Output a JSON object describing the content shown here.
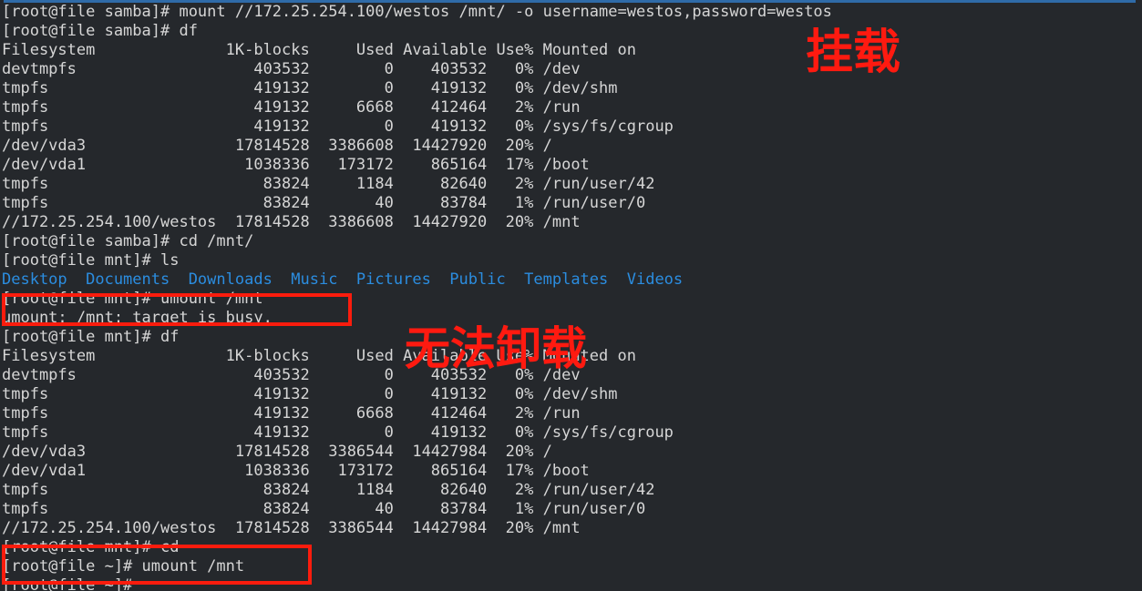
{
  "terminal": {
    "prompt_samba": "[root@file samba]# ",
    "prompt_mnt": "[root@file mnt]# ",
    "prompt_home": "[root@file ~]# ",
    "lines": [
      {
        "text": "[root@file samba]# mount //172.25.254.100/westos /mnt/ -o username=westos,password=westos",
        "color": "default"
      },
      {
        "text": "[root@file samba]# df",
        "color": "default"
      },
      {
        "text": "Filesystem              1K-blocks     Used Available Use% Mounted on",
        "color": "default"
      },
      {
        "text": "devtmpfs                   403532        0    403532   0% /dev",
        "color": "default"
      },
      {
        "text": "tmpfs                      419132        0    419132   0% /dev/shm",
        "color": "default"
      },
      {
        "text": "tmpfs                      419132     6668    412464   2% /run",
        "color": "default"
      },
      {
        "text": "tmpfs                      419132        0    419132   0% /sys/fs/cgroup",
        "color": "default"
      },
      {
        "text": "/dev/vda3                17814528  3386608  14427920  20% /",
        "color": "default"
      },
      {
        "text": "/dev/vda1                 1038336   173172    865164  17% /boot",
        "color": "default"
      },
      {
        "text": "tmpfs                       83824     1184     82640   2% /run/user/42",
        "color": "default"
      },
      {
        "text": "tmpfs                       83824       40     83784   1% /run/user/0",
        "color": "default"
      },
      {
        "text": "//172.25.254.100/westos  17814528  3386608  14427920  20% /mnt",
        "color": "default"
      },
      {
        "text": "[root@file samba]# cd /mnt/",
        "color": "default"
      },
      {
        "text": "[root@file mnt]# ls",
        "color": "default"
      },
      {
        "text": "Desktop  Documents  Downloads  Music  Pictures  Public  Templates  Videos",
        "color": "blue"
      },
      {
        "text": "[root@file mnt]# umount /mnt",
        "color": "default"
      },
      {
        "text": "umount: /mnt: target is busy.",
        "color": "default"
      },
      {
        "text": "[root@file mnt]# df",
        "color": "default"
      },
      {
        "text": "Filesystem              1K-blocks     Used Available Use% Mounted on",
        "color": "default"
      },
      {
        "text": "devtmpfs                   403532        0    403532   0% /dev",
        "color": "default"
      },
      {
        "text": "tmpfs                      419132        0    419132   0% /dev/shm",
        "color": "default"
      },
      {
        "text": "tmpfs                      419132     6668    412464   2% /run",
        "color": "default"
      },
      {
        "text": "tmpfs                      419132        0    419132   0% /sys/fs/cgroup",
        "color": "default"
      },
      {
        "text": "/dev/vda3                17814528  3386544  14427984  20% /",
        "color": "default"
      },
      {
        "text": "/dev/vda1                 1038336   173172    865164  17% /boot",
        "color": "default"
      },
      {
        "text": "tmpfs                       83824     1184     82640   2% /run/user/42",
        "color": "default"
      },
      {
        "text": "tmpfs                       83824       40     83784   1% /run/user/0",
        "color": "default"
      },
      {
        "text": "//172.25.254.100/westos  17814528  3386544  14427984  20% /mnt",
        "color": "default"
      },
      {
        "text": "[root@file mnt]# cd",
        "color": "default"
      },
      {
        "text": "[root@file ~]# umount /mnt",
        "color": "default"
      },
      {
        "text": "[root@file ~]#",
        "color": "default"
      }
    ],
    "df_table": {
      "headers": [
        "Filesystem",
        "1K-blocks",
        "Used",
        "Available",
        "Use%",
        "Mounted on"
      ],
      "first_run": [
        [
          "devtmpfs",
          "403532",
          "0",
          "403532",
          "0%",
          "/dev"
        ],
        [
          "tmpfs",
          "419132",
          "0",
          "419132",
          "0%",
          "/dev/shm"
        ],
        [
          "tmpfs",
          "419132",
          "6668",
          "412464",
          "2%",
          "/run"
        ],
        [
          "tmpfs",
          "419132",
          "0",
          "419132",
          "0%",
          "/sys/fs/cgroup"
        ],
        [
          "/dev/vda3",
          "17814528",
          "3386608",
          "14427920",
          "20%",
          "/"
        ],
        [
          "/dev/vda1",
          "1038336",
          "173172",
          "865164",
          "17%",
          "/boot"
        ],
        [
          "tmpfs",
          "83824",
          "1184",
          "82640",
          "2%",
          "/run/user/42"
        ],
        [
          "tmpfs",
          "83824",
          "40",
          "83784",
          "1%",
          "/run/user/0"
        ],
        [
          "//172.25.254.100/westos",
          "17814528",
          "3386608",
          "14427920",
          "20%",
          "/mnt"
        ]
      ],
      "second_run": [
        [
          "devtmpfs",
          "403532",
          "0",
          "403532",
          "0%",
          "/dev"
        ],
        [
          "tmpfs",
          "419132",
          "0",
          "419132",
          "0%",
          "/dev/shm"
        ],
        [
          "tmpfs",
          "419132",
          "6668",
          "412464",
          "2%",
          "/run"
        ],
        [
          "tmpfs",
          "419132",
          "0",
          "419132",
          "0%",
          "/sys/fs/cgroup"
        ],
        [
          "/dev/vda3",
          "17814528",
          "3386544",
          "14427984",
          "20%",
          "/"
        ],
        [
          "/dev/vda1",
          "1038336",
          "173172",
          "865164",
          "17%",
          "/boot"
        ],
        [
          "tmpfs",
          "83824",
          "1184",
          "82640",
          "2%",
          "/run/user/42"
        ],
        [
          "tmpfs",
          "83824",
          "40",
          "83784",
          "1%",
          "/run/user/0"
        ],
        [
          "//172.25.254.100/westos",
          "17814528",
          "3386544",
          "14427984",
          "20%",
          "/mnt"
        ]
      ]
    },
    "ls_entries": [
      "Desktop",
      "Documents",
      "Downloads",
      "Music",
      "Pictures",
      "Public",
      "Templates",
      "Videos"
    ]
  },
  "annotations": {
    "mount_label": "挂载",
    "cannot_unmount_label": "无法卸载"
  },
  "colors": {
    "background": "#25282c",
    "foreground": "#d6d6d6",
    "directory_blue": "#2b8de0",
    "annotation_red": "#ff1a10",
    "highlight_box_red": "#fb1c0d",
    "titlebar_blue": "#2f6ba8"
  }
}
